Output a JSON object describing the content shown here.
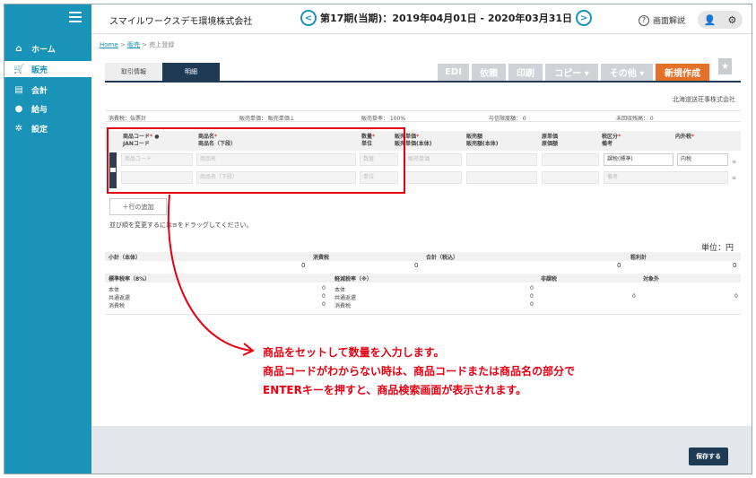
{
  "sidebar": {
    "items": [
      {
        "label": "ホーム",
        "icon": "home-icon"
      },
      {
        "label": "販売",
        "icon": "cart-icon"
      },
      {
        "label": "会計",
        "icon": "ledger-icon"
      },
      {
        "label": "給与",
        "icon": "money-bag-icon"
      },
      {
        "label": "設定",
        "icon": "gear-icon"
      }
    ],
    "bg_color": "#1a93b8"
  },
  "header": {
    "company": "スマイルワークスデモ環境株式会社",
    "period": "第17期(当期)：2019年04月01日 - 2020年03月31日",
    "prev_glyph": "<",
    "next_glyph": ">",
    "help_label": "画面解説",
    "user_glyph": "👤",
    "settings_glyph": "⚙"
  },
  "breadcrumb": {
    "home": "Home",
    "sep": ">",
    "sales": "販売",
    "current": "売上登録"
  },
  "tabs": [
    {
      "label": "取引情報"
    },
    {
      "label": "明細"
    }
  ],
  "actions": {
    "edi": "EDI",
    "request": "依頼",
    "print": "印刷",
    "copy": "コピー ▾",
    "other": "その他 ▾",
    "new": "新規作成",
    "accent": "#e4712a"
  },
  "customer": "北海道送荘事株式会社",
  "meta": {
    "tax": "消費税：伝票計",
    "price": "販売単価： 販売単価１",
    "rate": "販売掛率： 100%",
    "credit": "与信限度額： 0",
    "receivable": "未回収残高： 0"
  },
  "table": {
    "headers": {
      "code": "商品コード",
      "jan": "JANコード",
      "name": "商品名",
      "name_sub": "商品名（下段）",
      "qty": "数量",
      "unit": "単位",
      "unit_price": "販売単価",
      "unit_price_sub": "販売単価(本体)",
      "amount": "販売額",
      "amount_sub": "販売額(本体)",
      "cost": "原単価",
      "cost_sub": "原価額",
      "tax_class": "税区分",
      "note": "備考",
      "incl": "内外税"
    },
    "row": {
      "code_ph": "商品コード",
      "name_ph": "商品名",
      "name_sub_ph": "商品名（下段）",
      "qty_ph": "数量",
      "unit_ph": "単位",
      "price_ph": "販売単価",
      "tax_class": "課税(標準)",
      "incl": "内税",
      "note_ph": "備考"
    }
  },
  "add_row": "＋行の追加",
  "drag_note": "並び順を変更するには≡をドラッグしてください。",
  "unit_label": "単位：円",
  "totals": {
    "subtotal_label": "小計（本体）",
    "subtotal": "0",
    "tax_label": "消費税",
    "tax": "0",
    "total_label": "合計（税込）",
    "total": "0",
    "gross_label": "粗利計",
    "gross": "0"
  },
  "tax_breakdown": {
    "standard_label": "標準税率（8%）",
    "reduced_label": "軽減税率（※）",
    "exempt_label": "非課税",
    "out_label": "対象外",
    "body": "本体",
    "shared": "共通返還",
    "tax": "消費税",
    "zero": "0"
  },
  "callout": [
    "商品をセットして数量を入力します。",
    "商品コードがわからない時は、商品コードまたは商品名の部分で",
    "ENTERキーを押すと、商品検索画面が表示されます。"
  ],
  "save": "保存する"
}
